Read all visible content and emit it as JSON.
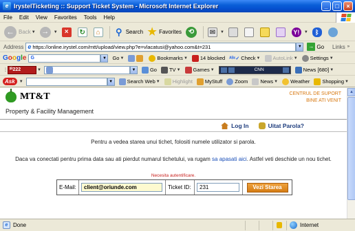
{
  "window": {
    "title": "IrystelTicketing :: Support Ticket System - Microsoft Internet Explorer"
  },
  "menu": [
    "File",
    "Edit",
    "View",
    "Favorites",
    "Tools",
    "Help"
  ],
  "toolbar": {
    "back": "Back",
    "search": "Search",
    "favorites": "Favorites"
  },
  "address": {
    "label": "Address",
    "url": "https://online.irystel.com/mtt/upload/view.php?e=vlacatusi@yahoo.com&t=231",
    "go": "Go",
    "links": "Links"
  },
  "google_bar": {
    "logo": [
      "G",
      "o",
      "o",
      "g",
      "l",
      "e"
    ],
    "field_value": "G",
    "go": "Go",
    "bookmarks": "Bookmarks",
    "blocked": "14 blocked",
    "check": "Check",
    "autolink": "AutoLink",
    "settings": "Settings"
  },
  "bar3": {
    "logo": "ᴵᴿ222",
    "go": "Go",
    "tv": "TV",
    "games": "Games",
    "cnn": "CNN",
    "news": "News [680]"
  },
  "ask_bar": {
    "logo": "Ask",
    "search_web": "Search Web",
    "highlight": "Highlight",
    "mystuff": "MyStuff",
    "zoom": "Zoom",
    "news": "News",
    "weather": "Weather",
    "shopping": "Shopping"
  },
  "page": {
    "brand": "MT&T",
    "tagline": "Property & Facility Management",
    "support_line1": "CENTRUL DE SUPORT",
    "support_line2": "BINE ATI VENIT",
    "login": "Log In",
    "forgot": "Uitat Parola?",
    "info1": "Pentru a vedea starea unui tichet, folositi numele utilizator si parola.",
    "info2_before": "Daca va conectati pentru prima data sau ati pierdut numarul tichetului, va rugam ",
    "info2_link": "sa apasati aici",
    "info2_after": ". Astfel veti deschide un nou tichet.",
    "auth_note": "Necesita autentificare.",
    "email_label": "E-Mail:",
    "email_value": "client@oriunde.com",
    "ticket_label": "Ticket ID:",
    "ticket_value": "231",
    "submit": "Vezi Starea"
  },
  "status": {
    "text": "Done",
    "zone": "Internet"
  },
  "colors": {
    "accent": "#d7760c",
    "link": "#1a4fb8",
    "alert": "#c8201d"
  }
}
